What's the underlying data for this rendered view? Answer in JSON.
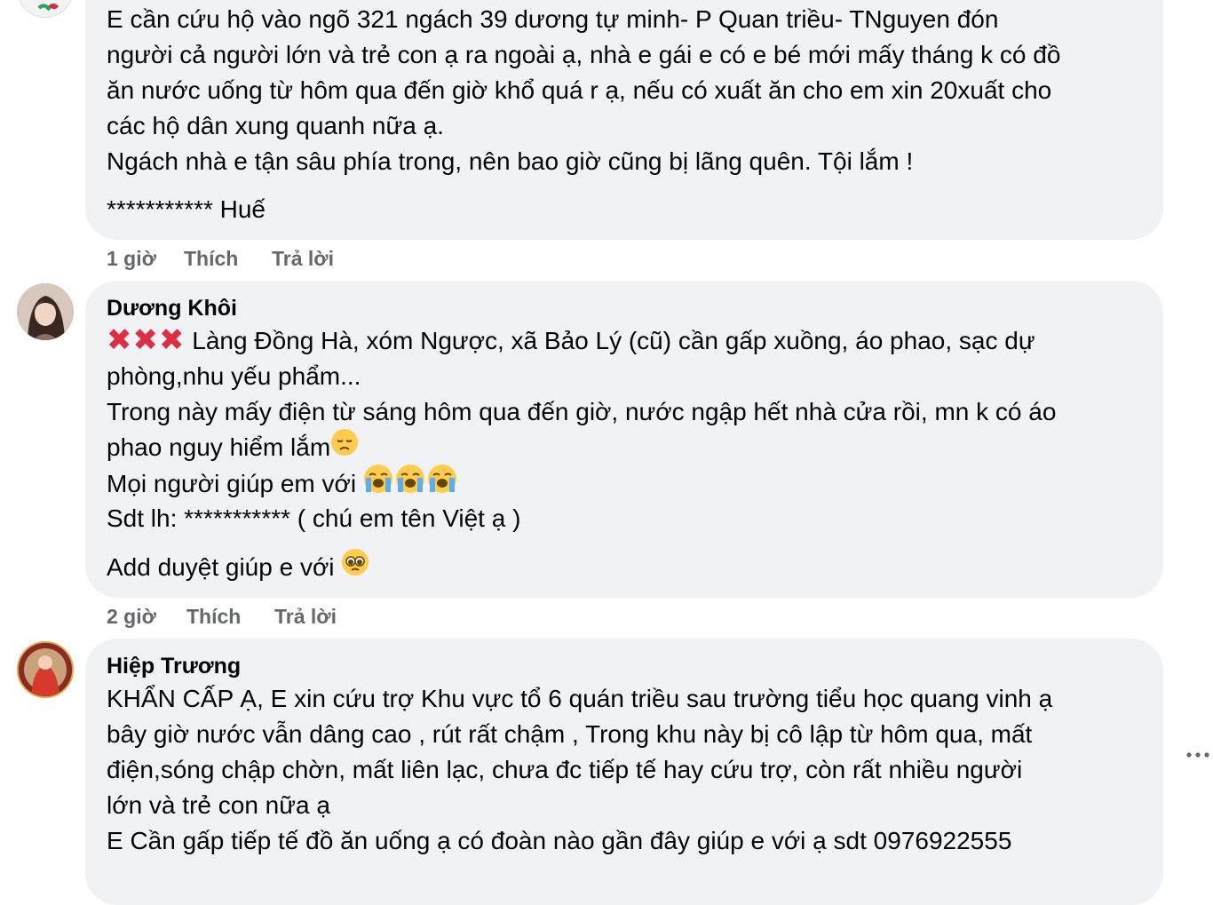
{
  "comments": [
    {
      "author": "",
      "lines": [
        "E cần cứu hộ vào ngõ 321 ngách 39 dương tự minh- P Quan triều- TNguyen đón",
        "người cả người lớn và trẻ con ạ ra ngoài ạ, nhà e gái e có e bé mới mấy tháng k có đồ",
        "ăn nước uống từ hôm qua đến giờ khổ quá r ạ, nếu có xuất ăn cho em xin 20xuất cho",
        "các hộ dân xung quanh nữa ạ.",
        "Ngách nhà e tận sâu phía trong, nên bao giờ cũng bị lãng quên. Tội lắm !",
        "*********** Huế"
      ],
      "time": "1 giờ",
      "like": "Thích",
      "reply": "Trả lời"
    },
    {
      "author": "Dương Khôi",
      "lines": [
        " Làng Đồng Hà, xóm Ngược, xã Bảo Lý (cũ) cần gấp xuồng, áo phao, sạc dự",
        "phòng,nhu yếu phẩm...",
        "Trong này mấy điện từ sáng hôm qua đến giờ, nước ngập hết nhà cửa rồi, mn k có áo",
        "phao nguy hiểm lắm",
        "Mọi người giúp em với ",
        "Sdt lh: *********** ( chú em tên Việt ạ )",
        "Add duyệt giúp e với "
      ],
      "icons": {
        "cross": "cross-mark-icon",
        "disappointed": "disappointed-face-icon",
        "crying": "loudly-crying-face-icon",
        "pleading": "pleading-face-icon"
      },
      "time": "2 giờ",
      "like": "Thích",
      "reply": "Trả lời"
    },
    {
      "author": "Hiệp Trương",
      "lines": [
        "KHẨN CẤP Ạ, E xin cứu trợ Khu vực tổ 6 quán triều sau trường tiểu học quang vinh ạ",
        "bây giờ nước vẫn dâng cao , rút rất chậm , Trong khu này bị cô lập từ hôm qua, mất",
        "điện,sóng chập chờn, mất liên lạc, chưa đc tiếp tế hay cứu trợ, còn rất nhiều người",
        "lớn và trẻ con nữa ạ",
        "E Cần gấp tiếp tế đồ ăn uống ạ có đoàn nào gần đây giúp e với ạ sdt 0976922555"
      ]
    }
  ],
  "colors": {
    "bubble": "#f0f2f5",
    "text": "#050505",
    "meta": "#65676b"
  }
}
